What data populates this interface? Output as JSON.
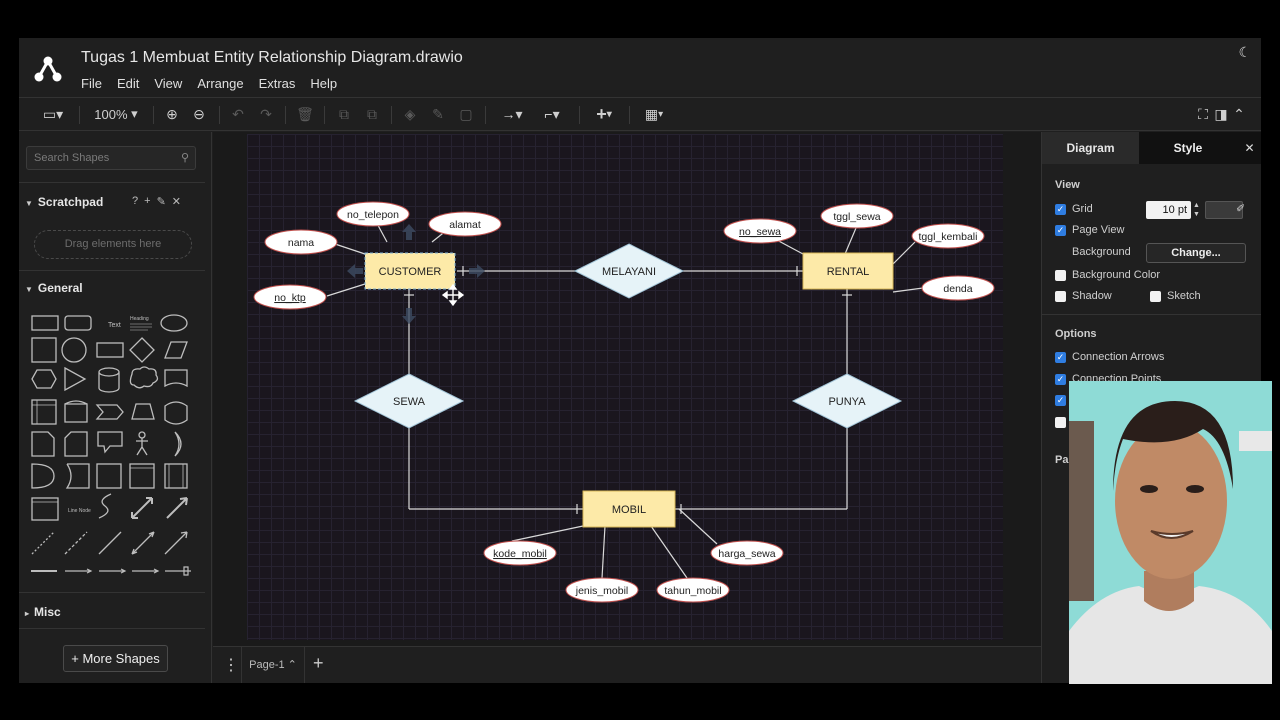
{
  "window": {
    "title": "Tugas 1 Membuat Entity Relationship Diagram.drawio"
  },
  "menu": [
    "File",
    "Edit",
    "View",
    "Arrange",
    "Extras",
    "Help"
  ],
  "toolbar": {
    "zoom": "100%"
  },
  "left_panel": {
    "search_placeholder": "Search Shapes",
    "scratchpad_label": "Scratchpad",
    "drop_hint": "Drag elements here",
    "general_label": "General",
    "misc_label": "Misc",
    "more_shapes_label": "+ More Shapes"
  },
  "diagram": {
    "entities": {
      "customer": "CUSTOMER",
      "rental": "RENTAL",
      "mobil": "MOBIL"
    },
    "relationships": {
      "melayani": "MELAYANI",
      "sewa": "SEWA",
      "punya": "PUNYA"
    },
    "attributes": {
      "no_telepon": "no_telepon",
      "alamat": "alamat",
      "nama": "nama",
      "no_ktp": "no_ktp",
      "no_sewa": "no_sewa",
      "tggl_sewa": "tggl_sewa",
      "tggl_kembali": "tggl_kembali",
      "denda": "denda",
      "kode_mobil": "kode_mobil",
      "jenis_mobil": "jenis_mobil",
      "tahun_mobil": "tahun_mobil",
      "harga_sewa": "harga_sewa"
    },
    "colors": {
      "entity_fill": "#fdeaa8",
      "relationship_fill": "#e6f3f8",
      "attribute_fill": "#ffffff",
      "attribute_stroke": "#c0504d"
    }
  },
  "page_tabs": {
    "current": "Page-1 ⌃"
  },
  "right_panel": {
    "tab_diagram": "Diagram",
    "tab_style": "Style",
    "view_label": "View",
    "grid_label": "Grid",
    "grid_size": "10 pt",
    "page_view_label": "Page View",
    "background_label": "Background",
    "change_label": "Change...",
    "background_color_label": "Background Color",
    "shadow_label": "Shadow",
    "sketch_label": "Sketch",
    "options_label": "Options",
    "connection_arrows_label": "Connection Arrows",
    "connection_points_label": "Connection Points",
    "partial_label": "Pa"
  }
}
